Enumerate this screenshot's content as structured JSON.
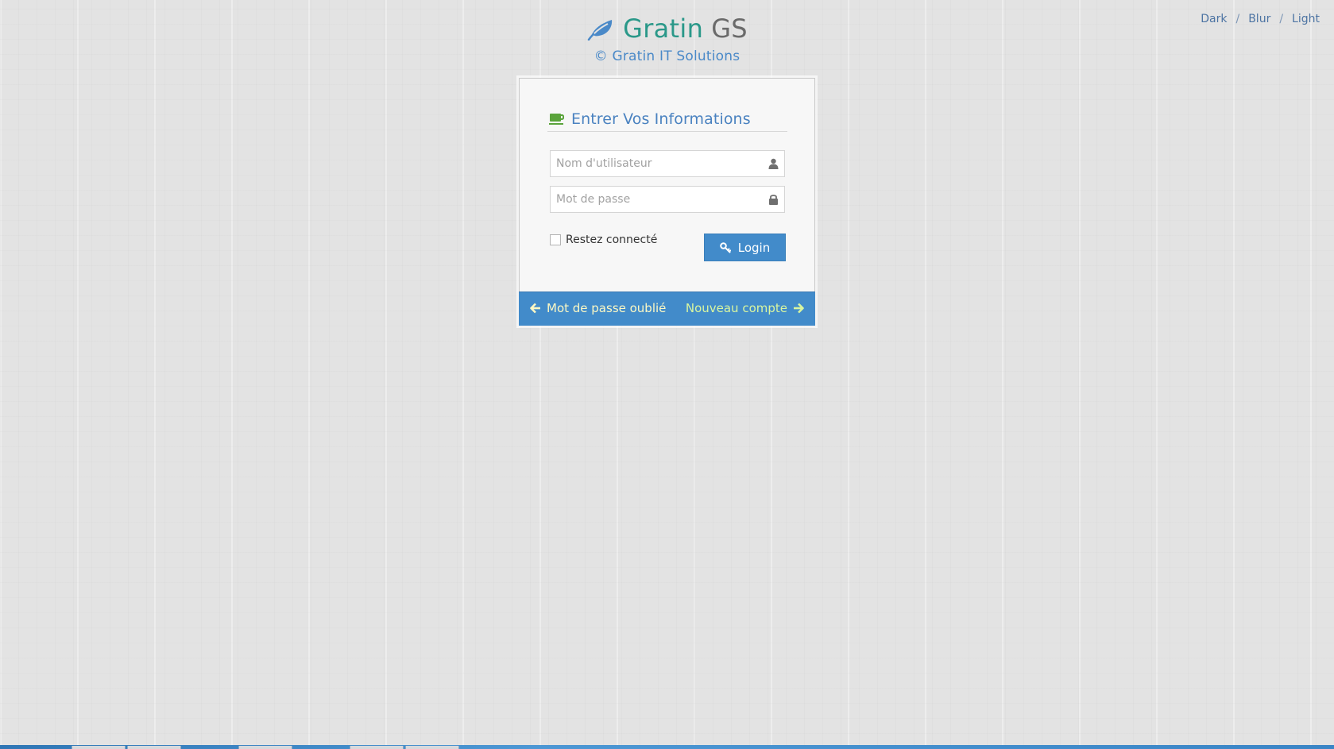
{
  "theme_switch": {
    "dark": "Dark",
    "blur": "Blur",
    "light": "Light",
    "separator": "/"
  },
  "brand": {
    "name_part1": "Gratin",
    "name_part2": "GS",
    "copyright": "© Gratin IT Solutions",
    "icon": "leaf-icon"
  },
  "login": {
    "heading": "Entrer Vos Informations",
    "heading_icon": "coffee-icon",
    "username_placeholder": "Nom d'utilisateur",
    "username_value": "",
    "username_icon": "user-icon",
    "password_placeholder": "Mot de passe",
    "password_value": "",
    "password_icon": "lock-icon",
    "remember_label": "Restez connecté",
    "remember_checked": false,
    "login_button": "Login",
    "login_icon": "key-icon"
  },
  "footer": {
    "forgot_password": "Mot de passe oublié",
    "new_account": "Nouveau compte"
  },
  "colors": {
    "primary": "#428bca",
    "brand_green": "#2a9889",
    "brand_gray": "#6a6a6a",
    "heading_blue": "#4a82c0",
    "forgot_link": "#fcf8c4",
    "new_account_link": "#d8f5a0",
    "background": "#e3e3e3"
  }
}
